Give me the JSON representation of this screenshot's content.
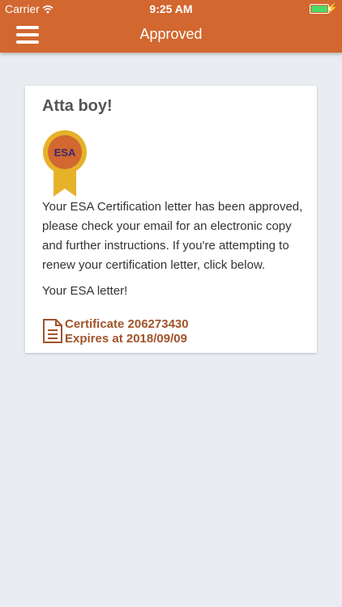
{
  "status_bar": {
    "carrier": "Carrier",
    "time": "9:25 AM"
  },
  "header": {
    "title": "Approved",
    "menu_icon": "hamburger-menu-icon"
  },
  "colors": {
    "brand": "#d2672f",
    "link": "#a1532a",
    "badge_gold": "#e5b22a",
    "badge_inner": "#d2672f",
    "badge_text": "#3a2b6b"
  },
  "card": {
    "heading": "Atta boy!",
    "badge_text": "ESA",
    "message": "Your ESA Certification letter has been approved, please check your email for an electronic copy and further instructions. If you're attempting to renew your certification letter, click below.",
    "letter_label": "Your ESA letter!",
    "certificate": {
      "number_line": "Certificate 206273430",
      "expires_line": "Expires at 2018/09/09",
      "icon": "document-icon"
    }
  }
}
